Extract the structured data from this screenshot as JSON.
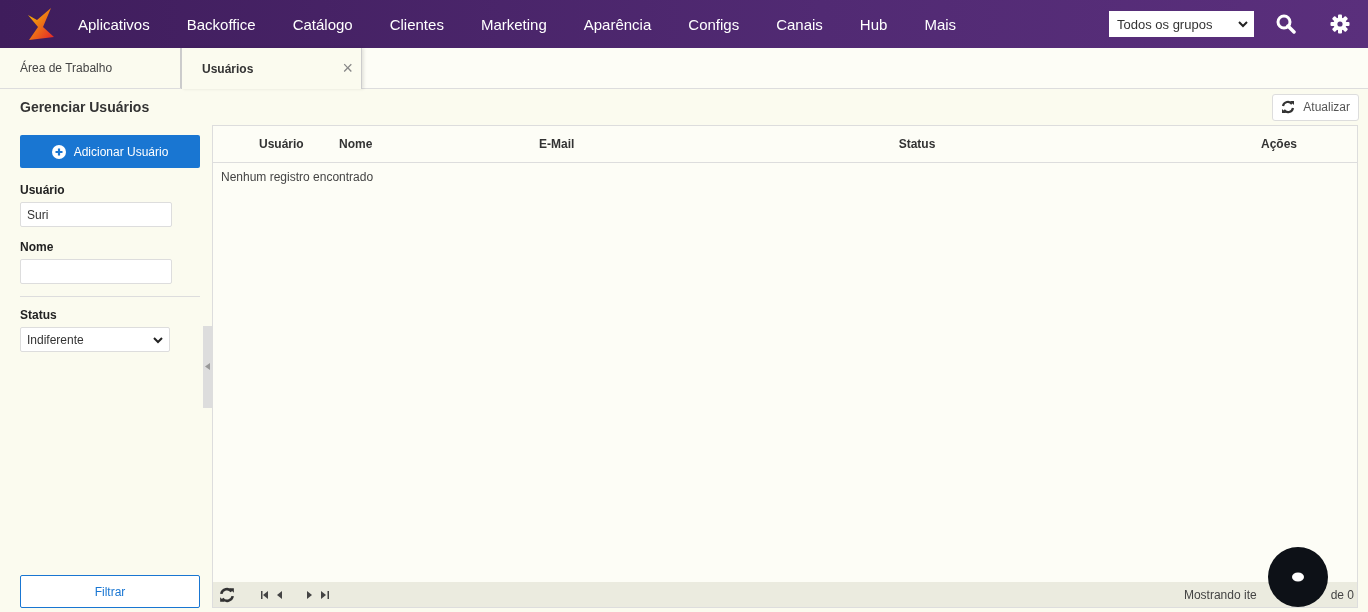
{
  "nav": {
    "items": [
      "Aplicativos",
      "Backoffice",
      "Catálogo",
      "Clientes",
      "Marketing",
      "Aparência",
      "Configs",
      "Canais",
      "Hub",
      "Mais"
    ],
    "group_select": "Todos os grupos"
  },
  "tabs": [
    {
      "label": "Área de Trabalho",
      "selected": false
    },
    {
      "label": "Usuários",
      "selected": true,
      "close": "×"
    }
  ],
  "page": {
    "title": "Gerenciar Usuários",
    "refresh_button": "Atualizar"
  },
  "filters": {
    "add_button": "Adicionar Usuário",
    "fields": [
      {
        "kind": "text",
        "label": "Usuário",
        "value": "Suri"
      },
      {
        "kind": "text",
        "label": "Nome"
      },
      {
        "kind": "select",
        "label": "Status",
        "value": "Indiferente"
      }
    ],
    "filter_button": "Filtrar"
  },
  "table": {
    "columns": [
      "Usuário",
      "Nome",
      "E-Mail",
      "Status",
      "Ações"
    ],
    "empty_message": "Nenhum registro encontrado",
    "pager": {
      "status_text": "Mostrando ite",
      "status_text_end": "de 0"
    }
  }
}
